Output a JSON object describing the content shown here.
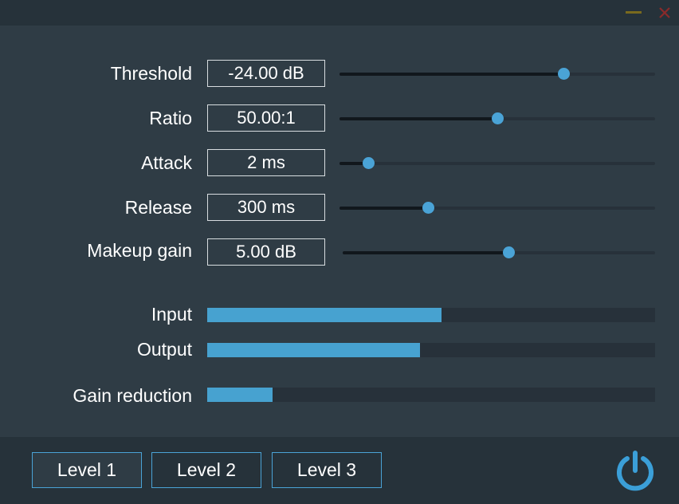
{
  "window": {
    "minimize_icon": "minimize-icon",
    "close_icon": "close-icon",
    "colors": {
      "minimize": "#7a6a1e",
      "close": "#8a2a2a"
    }
  },
  "params": [
    {
      "label": "Threshold",
      "value": "-24.00 dB",
      "slider_fraction": 0.71
    },
    {
      "label": "Ratio",
      "value": "50.00:1",
      "slider_fraction": 0.5
    },
    {
      "label": "Attack",
      "value": "2 ms",
      "slider_fraction": 0.09
    },
    {
      "label": "Release",
      "value": "300 ms",
      "slider_fraction": 0.28
    },
    {
      "label": "Makeup gain",
      "value": "5.00 dB",
      "slider_fraction": 0.53
    }
  ],
  "meters": [
    {
      "label": "Input",
      "level_fraction": 0.523
    },
    {
      "label": "Output",
      "level_fraction": 0.475
    },
    {
      "label": "Gain reduction",
      "level_fraction": 0.146
    }
  ],
  "footer": {
    "buttons": [
      {
        "label": "Level 1",
        "active": true
      },
      {
        "label": "Level 2",
        "active": false
      },
      {
        "label": "Level 3",
        "active": false
      }
    ],
    "power_icon": "power-icon"
  },
  "colors": {
    "accent": "#4aa3d6",
    "background": "#2f3c45",
    "panel": "#26323a",
    "slider_track": "#27313a",
    "slider_fill": "#11171c"
  }
}
